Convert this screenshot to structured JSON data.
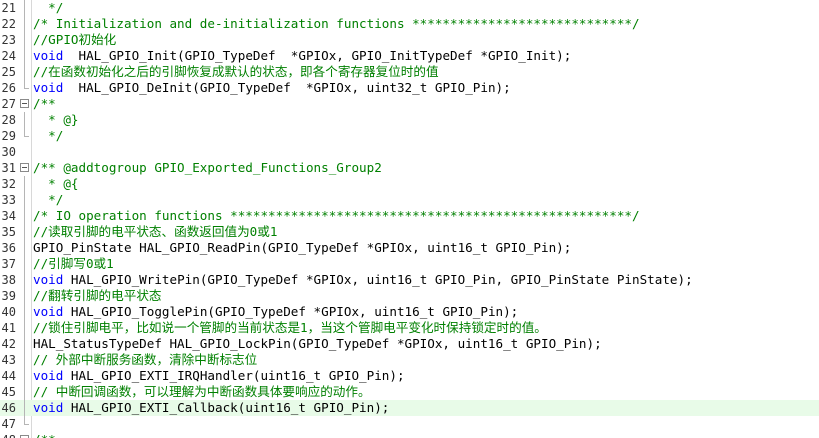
{
  "editor": {
    "colors": {
      "comment": "#008000",
      "keyword": "#0000ff",
      "text": "#000000",
      "current_line": "#e8fbe8"
    },
    "lines": [
      {
        "num": "21",
        "kind": "comment",
        "text": "  */",
        "fold": "line"
      },
      {
        "num": "22",
        "kind": "comment",
        "text": "/* Initialization and de-initialization functions *****************************/",
        "fold": "line"
      },
      {
        "num": "23",
        "kind": "comment",
        "text": "//GPIO初始化",
        "fold": "line"
      },
      {
        "num": "24",
        "kind": "decl",
        "kw": "void",
        "rest": "  HAL_GPIO_Init(GPIO_TypeDef  *GPIOx, GPIO_InitTypeDef *GPIO_Init);",
        "fold": "line"
      },
      {
        "num": "25",
        "kind": "comment",
        "text": "//在函数初始化之后的引脚恢复成默认的状态，即各个寄存器复位时的值",
        "fold": "line"
      },
      {
        "num": "26",
        "kind": "decl",
        "kw": "void",
        "rest": "  HAL_GPIO_DeInit(GPIO_TypeDef  *GPIOx, uint32_t GPIO_Pin);",
        "fold": "end"
      },
      {
        "num": "27",
        "kind": "comment",
        "text": "/**",
        "fold": "box"
      },
      {
        "num": "28",
        "kind": "comment",
        "text": "  * @}",
        "fold": "line"
      },
      {
        "num": "29",
        "kind": "comment",
        "text": "  */",
        "fold": "end"
      },
      {
        "num": "30",
        "kind": "plain",
        "text": "",
        "fold": "none"
      },
      {
        "num": "31",
        "kind": "comment",
        "text": "/** @addtogroup GPIO_Exported_Functions_Group2",
        "fold": "box"
      },
      {
        "num": "32",
        "kind": "comment",
        "text": "  * @{",
        "fold": "line"
      },
      {
        "num": "33",
        "kind": "comment",
        "text": "  */",
        "fold": "line"
      },
      {
        "num": "34",
        "kind": "comment",
        "text": "/* IO operation functions *****************************************************/",
        "fold": "line"
      },
      {
        "num": "35",
        "kind": "comment",
        "text": "//读取引脚的电平状态、函数返回值为0或1",
        "fold": "line"
      },
      {
        "num": "36",
        "kind": "plain",
        "text": "GPIO_PinState HAL_GPIO_ReadPin(GPIO_TypeDef *GPIOx, uint16_t GPIO_Pin);",
        "fold": "line"
      },
      {
        "num": "37",
        "kind": "comment",
        "text": "//引脚写0或1",
        "fold": "line"
      },
      {
        "num": "38",
        "kind": "decl",
        "kw": "void",
        "rest": " HAL_GPIO_WritePin(GPIO_TypeDef *GPIOx, uint16_t GPIO_Pin, GPIO_PinState PinState);",
        "fold": "line"
      },
      {
        "num": "39",
        "kind": "comment",
        "text": "//翻转引脚的电平状态",
        "fold": "line"
      },
      {
        "num": "40",
        "kind": "decl",
        "kw": "void",
        "rest": " HAL_GPIO_TogglePin(GPIO_TypeDef *GPIOx, uint16_t GPIO_Pin);",
        "fold": "line"
      },
      {
        "num": "41",
        "kind": "comment",
        "text": "//锁住引脚电平，比如说一个管脚的当前状态是1，当这个管脚电平变化时保持锁定时的值。",
        "fold": "line"
      },
      {
        "num": "42",
        "kind": "plain",
        "text": "HAL_StatusTypeDef HAL_GPIO_LockPin(GPIO_TypeDef *GPIOx, uint16_t GPIO_Pin);",
        "fold": "line"
      },
      {
        "num": "43",
        "kind": "comment",
        "text": "// 外部中断服务函数，清除中断标志位",
        "fold": "line"
      },
      {
        "num": "44",
        "kind": "decl",
        "kw": "void",
        "rest": " HAL_GPIO_EXTI_IRQHandler(uint16_t GPIO_Pin);",
        "fold": "line"
      },
      {
        "num": "45",
        "kind": "comment",
        "text": "// 中断回调函数，可以理解为中断函数具体要响应的动作。",
        "fold": "line"
      },
      {
        "num": "46",
        "kind": "decl",
        "kw": "void",
        "rest": " HAL_GPIO_EXTI_Callback(uint16_t GPIO_Pin);",
        "fold": "line",
        "current": true
      },
      {
        "num": "47",
        "kind": "plain",
        "text": "",
        "fold": "end"
      },
      {
        "num": "48",
        "kind": "comment",
        "text": "/**",
        "fold": "box"
      }
    ]
  }
}
